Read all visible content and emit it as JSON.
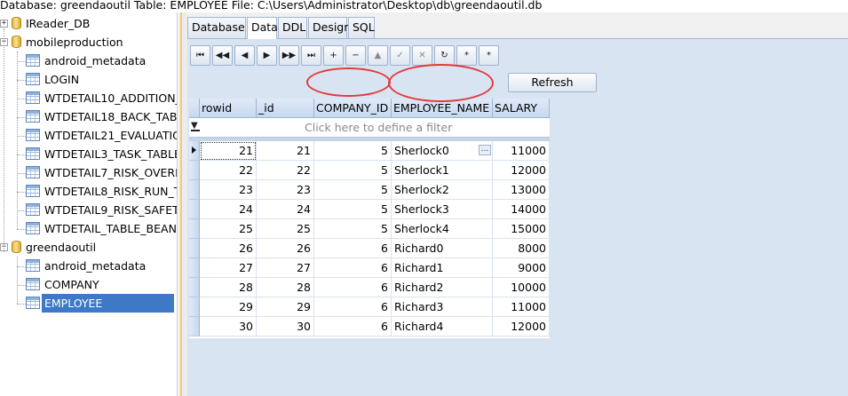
{
  "header": {
    "title": "Database: greendaoutil   Table: EMPLOYEE   File: C:\\Users\\Administrator\\Desktop\\db\\greendaoutil.db"
  },
  "tree": {
    "databases": [
      {
        "name": "IReader_DB",
        "expanded": false,
        "tables": []
      },
      {
        "name": "mobileproduction",
        "expanded": true,
        "tables": [
          "android_metadata",
          "LOGIN",
          "WTDETAIL10_ADDITION_",
          "WTDETAIL18_BACK_TABL",
          "WTDETAIL21_EVALUATIO",
          "WTDETAIL3_TASK_TABLE_",
          "WTDETAIL7_RISK_OVERH",
          "WTDETAIL8_RISK_RUN_T/",
          "WTDETAIL9_RISK_SAFETY",
          "WTDETAIL_TABLE_BEAN"
        ]
      },
      {
        "name": "greendaoutil",
        "expanded": true,
        "tables": [
          "android_metadata",
          "COMPANY",
          "EMPLOYEE"
        ]
      }
    ],
    "selected": "EMPLOYEE",
    "collapsed_symbol": "+",
    "expanded_symbol": "−"
  },
  "tabs": [
    "Database",
    "Data",
    "DDL",
    "Design",
    "SQL"
  ],
  "active_tab": "Data",
  "toolbar": {
    "nav_icons": [
      "first-page-icon",
      "prev-page-icon",
      "prev-record-icon",
      "next-record-icon",
      "next-page-icon",
      "last-page-icon",
      "insert-icon",
      "delete-icon",
      "edit-icon",
      "post-icon",
      "cancel-icon",
      "refresh-data-icon",
      "set-autoinc-icon",
      "clear-autoinc-icon"
    ],
    "nav_glyphs": [
      "⏮",
      "◀◀",
      "◀",
      "▶",
      "▶▶",
      "⏭",
      "+",
      "−",
      "▲",
      "✓",
      "✕",
      "↻",
      "*",
      "*"
    ],
    "refresh_label": "Refresh"
  },
  "grid": {
    "columns": [
      "rowid",
      "_id",
      "COMPANY_ID",
      "EMPLOYEE_NAME",
      "SALARY"
    ],
    "filter_placeholder": "Click here to define a filter",
    "edit_button_label": "...",
    "rows": [
      [
        "21",
        "21",
        "5",
        "Sherlock0",
        "11000"
      ],
      [
        "22",
        "22",
        "5",
        "Sherlock1",
        "12000"
      ],
      [
        "23",
        "23",
        "5",
        "Sherlock2",
        "13000"
      ],
      [
        "24",
        "24",
        "5",
        "Sherlock3",
        "14000"
      ],
      [
        "25",
        "25",
        "5",
        "Sherlock4",
        "15000"
      ],
      [
        "26",
        "26",
        "6",
        "Richard0",
        "8000"
      ],
      [
        "27",
        "27",
        "6",
        "Richard1",
        "9000"
      ],
      [
        "28",
        "28",
        "6",
        "Richard2",
        "10000"
      ],
      [
        "29",
        "29",
        "6",
        "Richard3",
        "11000"
      ],
      [
        "30",
        "30",
        "6",
        "Richard4",
        "12000"
      ]
    ],
    "current_row": 0,
    "annotated_columns": [
      "COMPANY_ID",
      "EMPLOYEE_NAME"
    ]
  },
  "colors": {
    "selection": "#3d79c6",
    "annotation": "#e23b3b",
    "header_bg": "#c6d8ef"
  }
}
